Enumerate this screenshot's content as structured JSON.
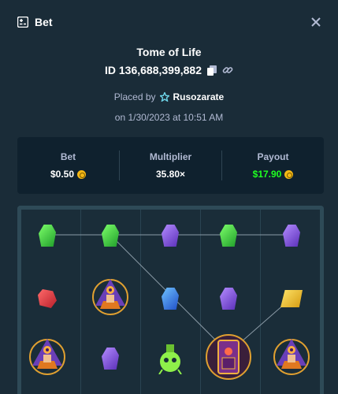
{
  "header": {
    "title": "Bet",
    "icon": "bet-slip-icon",
    "close_icon": "close-icon"
  },
  "game": {
    "title": "Tome of Life",
    "bet_id": "ID 136,688,399,882",
    "placed_by_prefix": "Placed by",
    "user": "Rusozarate",
    "date": "on 1/30/2023 at 10:51 AM"
  },
  "stats": {
    "bet_label": "Bet",
    "bet_value": "$0.50",
    "multiplier_label": "Multiplier",
    "multiplier_value": "35.80×",
    "payout_label": "Payout",
    "payout_value": "$17.90"
  },
  "board": {
    "grid": [
      [
        "green-gem",
        "green-gem",
        "purple-gem",
        "green-gem",
        "purple-gem"
      ],
      [
        "red-gem",
        "wizard-symbol",
        "blue-gem",
        "purple-gem",
        "yellow-gem"
      ],
      [
        "wizard-symbol",
        "purple-gem",
        "potion-symbol",
        "tome-scatter-symbol",
        "wizard-symbol"
      ]
    ]
  },
  "colors": {
    "background": "#1a2c38",
    "panel": "#0f212e",
    "payout": "#1fff20",
    "coin": "#f5b814"
  }
}
